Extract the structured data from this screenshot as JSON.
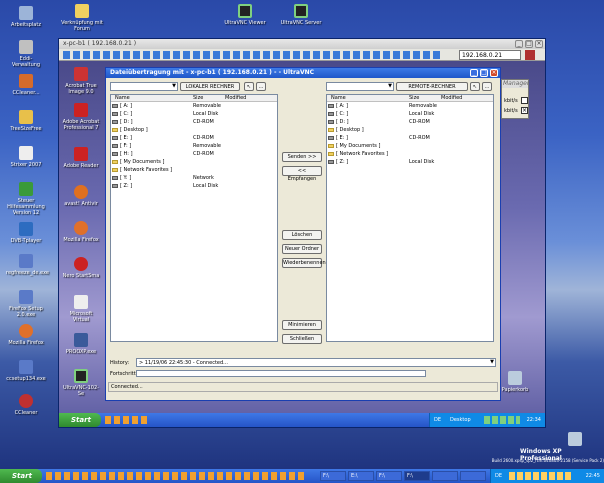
{
  "desktop_icons_left": [
    {
      "label": "Arbeitsplatz"
    },
    {
      "label": "Eddi-Verwaltung"
    },
    {
      "label": "CCleaner..."
    },
    {
      "label": "TreeSizeFree"
    },
    {
      "label": "Strixer 2007"
    },
    {
      "label": "Steuer Hilfesammlung Version 12"
    },
    {
      "label": "DVB-Tplayer"
    },
    {
      "label": "regfreeze_de.exe"
    },
    {
      "label": "FireFox Setup 2.0.exe"
    },
    {
      "label": "Mozilla Firefox"
    },
    {
      "label": "ccsetup134.exe"
    },
    {
      "label": "CCleaner"
    }
  ],
  "desktop_icons_top": [
    {
      "label": "Verknüpfung mit Forum"
    },
    {
      "label": "UltraVNC Viewer"
    },
    {
      "label": "UltraVNC Server"
    }
  ],
  "remote_desktop_icons": [
    {
      "label": "Acrobat True Image 9.0"
    },
    {
      "label": "Adobe Acrobat Professional 7"
    },
    {
      "label": "Adobe Reader"
    },
    {
      "label": "avast! Antivir"
    },
    {
      "label": "Mozilla Firefox"
    },
    {
      "label": "Nero StartSma"
    },
    {
      "label": "Microsoft Virtual"
    },
    {
      "label": "PROOXP.exe"
    },
    {
      "label": "UltraVNC-102-Se"
    }
  ],
  "vnc_viewer": {
    "title": "x-pc-b1 ( 192.168.0.21 )",
    "host_field": "192.168.0.21"
  },
  "file_transfer": {
    "title": "Dateiübertragung mit - x-pc-b1 ( 192.168.0.21 ) - - UltraVNC",
    "local_label": "LOKALER RECHNER",
    "remote_label": "REMOTE-RECHNER",
    "columns": {
      "name": "Name",
      "size": "Size",
      "modified": "Modified"
    },
    "local_rows": [
      {
        "name": "[ A: ]",
        "size": "Removable",
        "kind": "drive"
      },
      {
        "name": "[ C: ]",
        "size": "Local Disk",
        "kind": "drive"
      },
      {
        "name": "[ D: ]",
        "size": "CD-ROM",
        "kind": "drive"
      },
      {
        "name": "[ Desktop ]",
        "size": "",
        "kind": "folder"
      },
      {
        "name": "[ E: ]",
        "size": "CD-ROM",
        "kind": "drive"
      },
      {
        "name": "[ F: ]",
        "size": "Removable",
        "kind": "drive"
      },
      {
        "name": "[ H: ]",
        "size": "CD-ROM",
        "kind": "drive"
      },
      {
        "name": "[ My Documents ]",
        "size": "",
        "kind": "folder"
      },
      {
        "name": "[ Network Favorites ]",
        "size": "",
        "kind": "folder"
      },
      {
        "name": "[ Y: ]",
        "size": "Network",
        "kind": "drive"
      },
      {
        "name": "[ Z: ]",
        "size": "Local Disk",
        "kind": "drive"
      }
    ],
    "remote_rows": [
      {
        "name": "[ A: ]",
        "size": "Removable",
        "kind": "drive"
      },
      {
        "name": "[ C: ]",
        "size": "Local Disk",
        "kind": "drive"
      },
      {
        "name": "[ D: ]",
        "size": "CD-ROM",
        "kind": "drive"
      },
      {
        "name": "[ Desktop ]",
        "size": "",
        "kind": "folder"
      },
      {
        "name": "[ E: ]",
        "size": "CD-ROM",
        "kind": "drive"
      },
      {
        "name": "[ My Documents ]",
        "size": "",
        "kind": "folder"
      },
      {
        "name": "[ Network Favorites ]",
        "size": "",
        "kind": "folder"
      },
      {
        "name": "[ Z: ]",
        "size": "Local Disk",
        "kind": "drive"
      }
    ],
    "buttons": {
      "send": "Senden >>",
      "receive": "<< Empfangen",
      "delete": "Löschen",
      "new_folder": "Neuer Ordner",
      "rename": "Wiederbenennen",
      "minimize": "Minimieren",
      "close": "Schließen"
    },
    "history_label": "History:",
    "history_value": "> 11/19/06 22:45:30 - Connected...",
    "progress_label": "Fortschritt:",
    "progress": 0,
    "status": "Connected..."
  },
  "manager_panel": {
    "title": "Manager",
    "rate1": "kbit/s",
    "rate2": "kbit/s"
  },
  "recycle_bin": {
    "label": "Papierkorb"
  },
  "remote_taskbar": {
    "start": "Start",
    "lang": "DE",
    "desktop_label": "Desktop",
    "clock": "22:34"
  },
  "local_taskbar": {
    "start": "Start",
    "lang": "DE",
    "clock": "22:45",
    "items": [
      "F:\\",
      "E:\\",
      "F:\\",
      "F:\\",
      "",
      "",
      "",
      ""
    ]
  },
  "winxp": {
    "brand": "Windows XP Professional",
    "build": "Build 2600.xpsp_sp2_rtm.040803-2158 (Service Pack 2)"
  },
  "colors": {
    "xp_blue": "#2554c7",
    "start_green": "#2f8a2f",
    "panel_gray": "#ece9d8"
  }
}
